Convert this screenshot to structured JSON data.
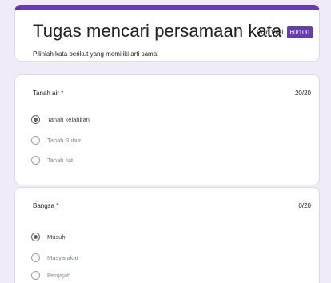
{
  "form": {
    "title": "Tugas mencari persamaan kata",
    "points_label": "Poin total",
    "points_value": "60/100",
    "description": "Pilihlah kata berikut yang memiliki arti sama!",
    "accent_color": "#673ab7",
    "background_color": "#f0ebf8"
  },
  "questions": [
    {
      "title": "Tanah air *",
      "score": "20/20",
      "options": [
        {
          "label": "Tanah kelahiran",
          "selected": true
        },
        {
          "label": "Tanah Subur",
          "selected": false
        },
        {
          "label": "Tanah liat",
          "selected": false
        }
      ]
    },
    {
      "title": "Bangsa *",
      "score": "0/20",
      "options": [
        {
          "label": "Musuh",
          "selected": true
        },
        {
          "label": "Masyarakat",
          "selected": false
        },
        {
          "label": "Penjajah",
          "selected": false
        }
      ]
    }
  ]
}
